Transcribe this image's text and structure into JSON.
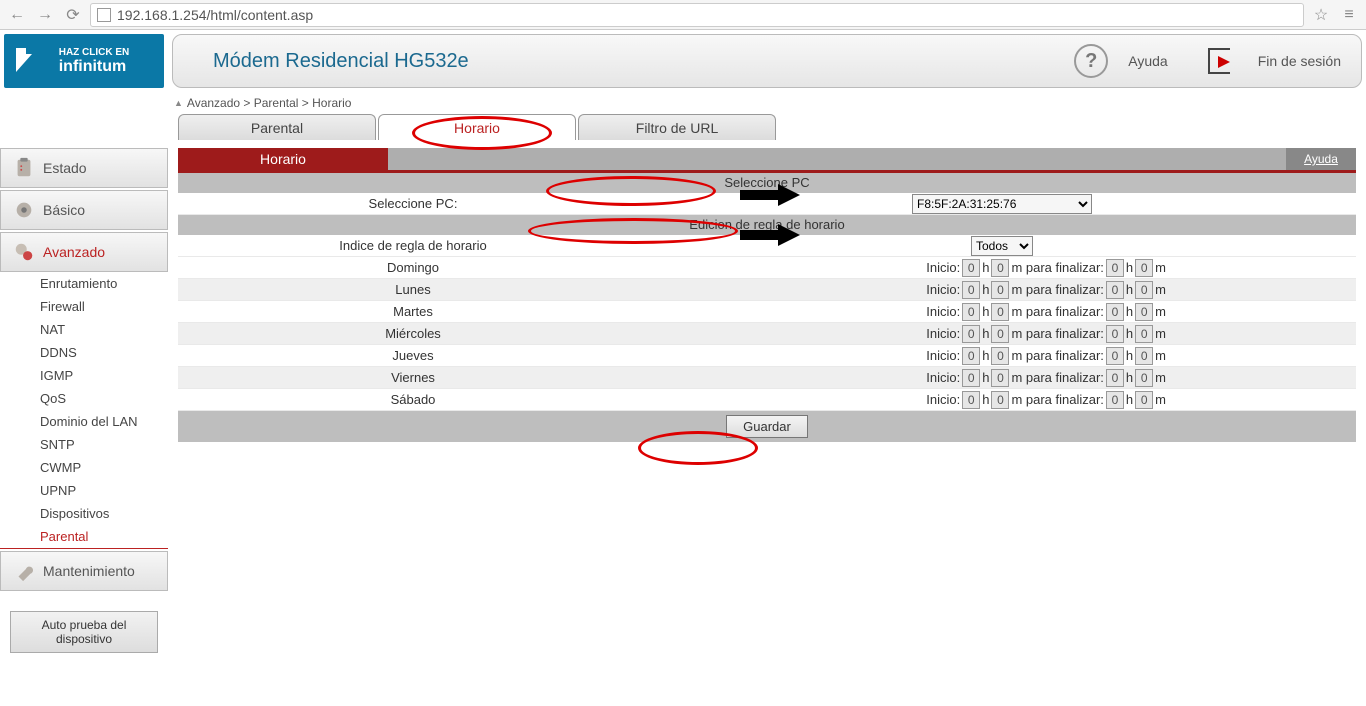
{
  "url": "192.168.1.254/html/content.asp",
  "logo": {
    "line1": "HAZ CLICK EN",
    "line2": "infinitum"
  },
  "header": {
    "title": "Módem Residencial HG532e",
    "help": "Ayuda",
    "logout": "Fin de sesión"
  },
  "breadcrumb": "Avanzado > Parental > Horario",
  "categories": {
    "estado": "Estado",
    "basico": "Básico",
    "avanzado": "Avanzado",
    "mantenimiento": "Mantenimiento"
  },
  "advancedItems": [
    "Enrutamiento",
    "Firewall",
    "NAT",
    "DDNS",
    "IGMP",
    "QoS",
    "Dominio del LAN",
    "SNTP",
    "CWMP",
    "UPNP",
    "Dispositivos",
    "Parental"
  ],
  "autotest": "Auto prueba del dispositivo",
  "tabs": {
    "parental": "Parental",
    "horario": "Horario",
    "filtro": "Filtro de URL"
  },
  "sectionTitle": "Horario",
  "helpLink": "Ayuda",
  "selectPC": {
    "band": "Seleccione PC",
    "label": "Seleccione PC:",
    "value": "F8:5F:2A:31:25:76"
  },
  "edit": {
    "band": "Edicion de regla de horario",
    "label": "Indice de regla de horario",
    "value": "Todos"
  },
  "days": [
    "Domingo",
    "Lunes",
    "Martes",
    "Miércoles",
    "Jueves",
    "Viernes",
    "Sábado"
  ],
  "timeLabels": {
    "inicio": "Inicio:",
    "h": "h",
    "m": "m",
    "finalizar": "para finalizar:"
  },
  "save": "Guardar"
}
